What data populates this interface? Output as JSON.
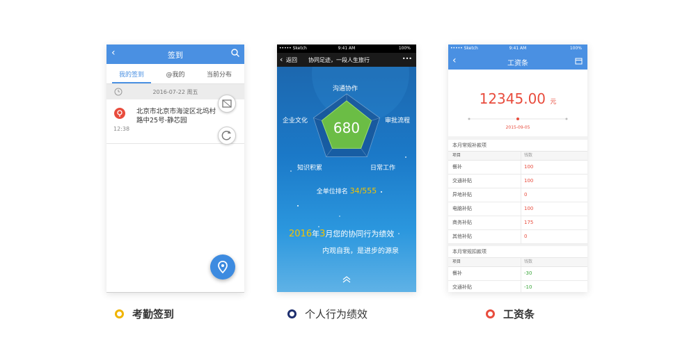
{
  "app1": {
    "title": "签到",
    "back": "‹",
    "tabs": [
      "我的签到",
      "@我的",
      "当前分布"
    ],
    "date": "2016-07-22 周五",
    "address": "北京市北京市海淀区北坞村路中25号-静芯园",
    "time": "12:38",
    "icons": [
      "search-icon",
      "clock-icon",
      "map-pin-icon",
      "map-icon",
      "refresh-icon",
      "location-icon"
    ]
  },
  "app2": {
    "status": {
      "carrier": "••••• Sketch",
      "time": "9:41 AM",
      "battery": "100%"
    },
    "back_label": "返回",
    "title": "协同足迹，一段人生旅行",
    "more": "•••",
    "score": "680",
    "radar_labels": [
      "沟通协作",
      "审批流程",
      "日常工作",
      "知识积累",
      "企业文化"
    ],
    "radar_values": [
      0.8,
      0.75,
      0.7,
      0.7,
      0.75
    ],
    "rank_label": "全单位排名",
    "rank_value": "34/555",
    "year": "2016",
    "year_mid": "年",
    "month": "3",
    "year_rest": "月您的协同行为绩效",
    "motto": "内观自我，是进步的源泉",
    "colors": {
      "radar_fill": "#6bbd45",
      "accent": "#f5c400"
    }
  },
  "app3": {
    "status": {
      "carrier": "••••• Sketch",
      "time": "9:41 AM",
      "battery": "100%"
    },
    "title": "工资条",
    "amount": "12345.00",
    "unit": "元",
    "date": "2015-09-05",
    "sections": [
      {
        "title": "本月常规补款项",
        "head": [
          "项目",
          "钱数"
        ],
        "rows": [
          [
            "餐补",
            "100"
          ],
          [
            "交通补贴",
            "100"
          ],
          [
            "异地补贴",
            "0"
          ],
          [
            "电脑补贴",
            "100"
          ],
          [
            "商务补贴",
            "175"
          ],
          [
            "其他补贴",
            "0"
          ]
        ],
        "value_color": "#e84c3d"
      },
      {
        "title": "本月常规扣款项",
        "head": [
          "项目",
          "钱数"
        ],
        "rows": [
          [
            "餐补",
            "-30"
          ],
          [
            "交通补贴",
            "-10"
          ]
        ],
        "value_color": "#3aa63a"
      }
    ]
  },
  "captions": [
    {
      "text": "考勤签到",
      "color": "#f0b400"
    },
    {
      "text": "个人行为绩效",
      "color": "#1e2f6e"
    },
    {
      "text": "工资条",
      "color": "#e84c3d"
    }
  ]
}
